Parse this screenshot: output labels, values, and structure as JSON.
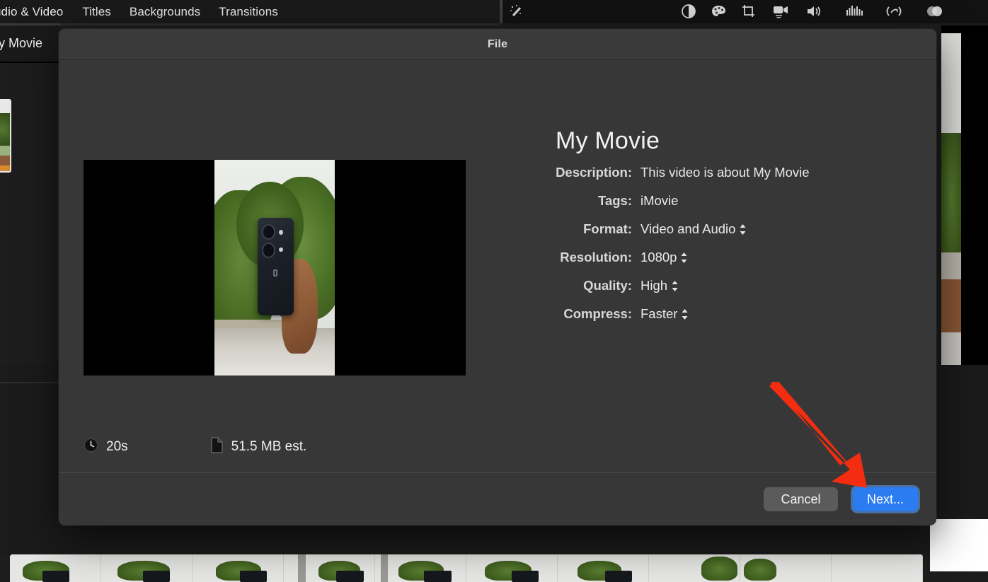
{
  "app": {
    "name": "iMovie",
    "browser_tabs": [
      {
        "id": "audio-video",
        "label": "udio & Video"
      },
      {
        "id": "titles",
        "label": "Titles"
      },
      {
        "id": "backgrounds",
        "label": "Backgrounds"
      },
      {
        "id": "transitions",
        "label": "Transitions"
      }
    ],
    "toolbar_icons": [
      {
        "name": "magic-wand-icon",
        "label": "Auto Enhance"
      },
      {
        "name": "color-balance-icon",
        "label": "Color Balance"
      },
      {
        "name": "color-correction-icon",
        "label": "Color Correction"
      },
      {
        "name": "crop-icon",
        "label": "Cropping"
      },
      {
        "name": "stabilization-icon",
        "label": "Stabilization"
      },
      {
        "name": "volume-icon",
        "label": "Volume"
      },
      {
        "name": "noise-reduction-icon",
        "label": "Noise Reduction and Equalizer"
      },
      {
        "name": "speed-icon",
        "label": "Speed"
      },
      {
        "name": "filters-icon",
        "label": "Clip Filter and Audio Effects"
      }
    ],
    "project_title": "y Movie"
  },
  "dialog": {
    "title": "File",
    "movie_title": "My Movie",
    "fields": [
      {
        "label": "Description:",
        "value": "This video is about My Movie",
        "type": "text",
        "stepper": false
      },
      {
        "label": "Tags:",
        "value": "iMovie",
        "type": "text",
        "stepper": false
      },
      {
        "label": "Format:",
        "value": "Video and Audio",
        "type": "select",
        "stepper": true
      },
      {
        "label": "Resolution:",
        "value": "1080p",
        "type": "select",
        "stepper": true
      },
      {
        "label": "Quality:",
        "value": "High",
        "type": "select",
        "stepper": true
      },
      {
        "label": "Compress:",
        "value": "Faster",
        "type": "select",
        "stepper": true
      }
    ],
    "stats": {
      "duration_icon": "clock-icon",
      "duration": "20s",
      "size_icon": "document-icon",
      "size": "51.5 MB est."
    },
    "buttons": {
      "cancel": "Cancel",
      "next": "Next..."
    }
  },
  "annotation": {
    "arrow_color": "#F42D10",
    "points_to": "next-button"
  },
  "colors": {
    "accent_blue": "#2a7cf0",
    "focus_ring": "#5ca0f5",
    "dialog_bg": "#373737",
    "titlebar_bg": "#3a3a3a",
    "cancel_gray": "#5b5b5b",
    "app_bg": "#1d1d1d",
    "annotation_red": "#F42D10"
  },
  "stepper_glyph": "⌃⌄"
}
